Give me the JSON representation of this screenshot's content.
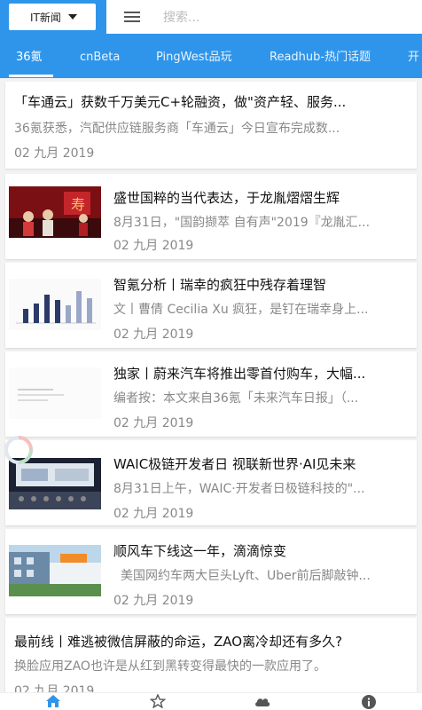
{
  "header": {
    "category_label": "IT新闻",
    "search_placeholder": "搜索..."
  },
  "tabs": [
    {
      "label": "36氪"
    },
    {
      "label": "cnBeta"
    },
    {
      "label": "PingWest品玩"
    },
    {
      "label": "Readhub-热门话题"
    },
    {
      "label": "开"
    }
  ],
  "articles": [
    {
      "title": "「车通云」获数千万美元C+轮融资，做\"资产轻、服务...",
      "summary": "36氪获悉，汽配供应链服务商「车通云」今日宣布完成数...",
      "date": "02 九月 2019"
    },
    {
      "title": "盛世国粹的当代表达，于龙胤熠熠生辉",
      "summary": "8月31日，\"国韵撷萃 自有声\"2019『龙胤汇...",
      "date": "02 九月 2019"
    },
    {
      "title": "智氪分析丨瑞幸的疯狂中残存着理智",
      "summary": "文丨曹倩 Cecilia Xu  疯狂，是钉在瑞幸身上...",
      "date": "02 九月 2019"
    },
    {
      "title": "独家丨蔚来汽车将推出零首付购车，大幅...",
      "summary": "编者按：本文来自36氪「未来汽车日报」（...",
      "date": "02 九月 2019"
    },
    {
      "title": "WAIC极链开发者日 视联新世界·AI见未来",
      "summary": "8月31日上午，WAIC·开发者日极链科技的\"...",
      "date": "02 九月 2019"
    },
    {
      "title": "顺风车下线这一年，滴滴惊变",
      "summary": "美国网约车两大巨头Lyft、Uber前后脚敲钟...",
      "date": "02 九月 2019"
    },
    {
      "title": "最前线丨难逃被微信屏蔽的命运，ZAO离冷却还有多久?",
      "summary": "换脸应用ZAO也许是从红到黑转变得最快的一款应用了。",
      "date": "02 九月 2019"
    }
  ],
  "bottom_nav": [
    {
      "icon": "home-icon"
    },
    {
      "icon": "star-icon"
    },
    {
      "icon": "cloud-icon"
    },
    {
      "icon": "info-icon"
    }
  ],
  "colors": {
    "primary": "#2f95ea",
    "nav_active": "#2f95ea",
    "nav_inactive": "#555555"
  }
}
